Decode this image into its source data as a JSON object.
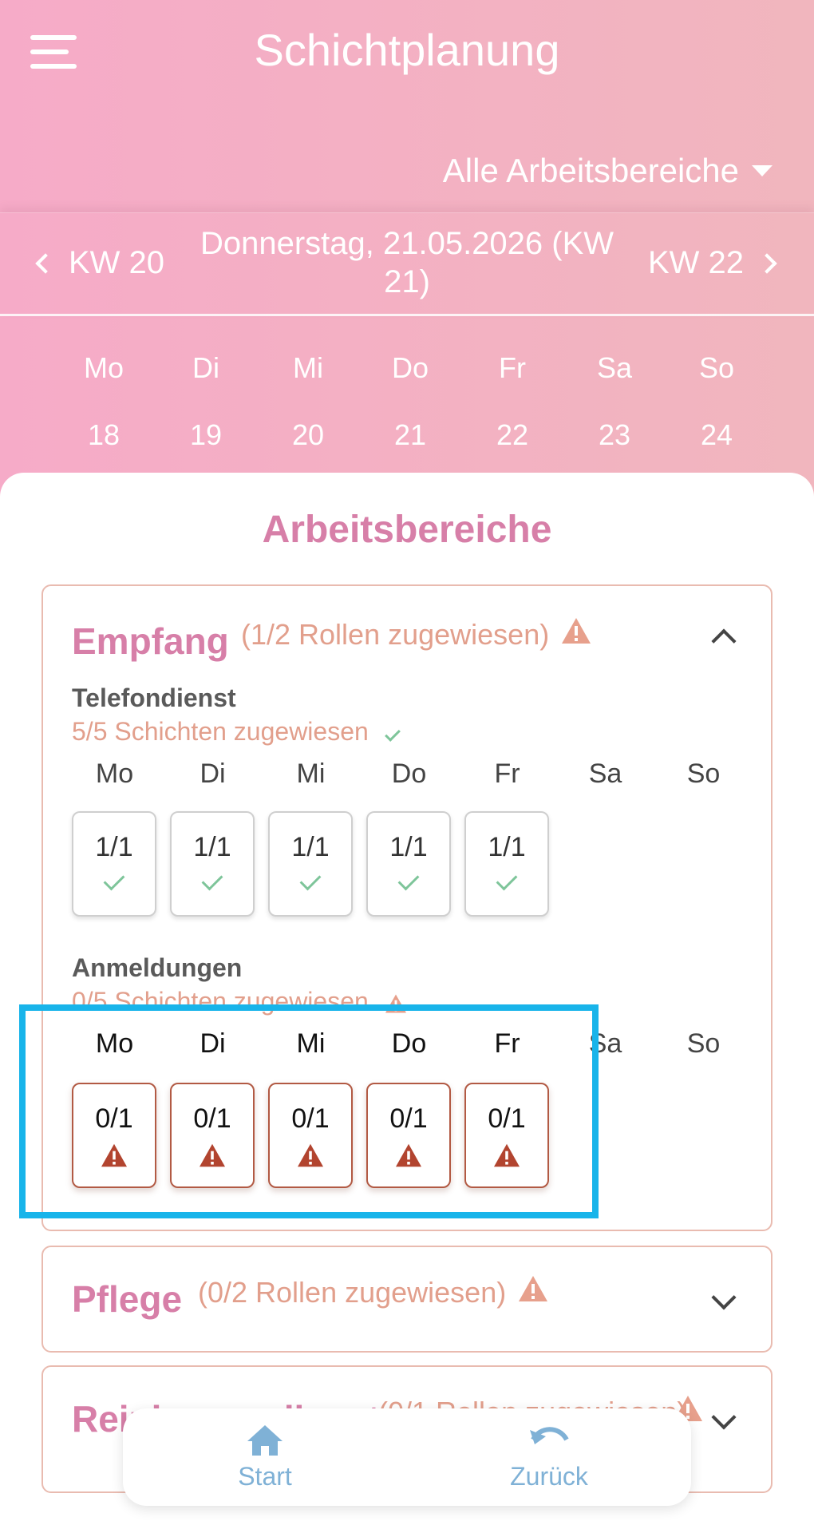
{
  "header": {
    "title": "Schichtplanung",
    "area_filter": "Alle Arbeitsbereiche"
  },
  "week_nav": {
    "prev": "KW 20",
    "current": "Donnerstag, 21.05.2026 (KW 21)",
    "next": "KW 22"
  },
  "week": {
    "days": [
      "Mo",
      "Di",
      "Mi",
      "Do",
      "Fr",
      "Sa",
      "So"
    ],
    "dates": [
      "18",
      "19",
      "20",
      "21",
      "22",
      "23",
      "24"
    ]
  },
  "sheet": {
    "title": "Arbeitsbereiche"
  },
  "areas": [
    {
      "name": "Empfang",
      "status": "(1/2 Rollen zugewiesen)",
      "roles": [
        {
          "name": "Telefondienst",
          "status": "5/5 Schichten zugewiesen",
          "days": [
            "Mo",
            "Di",
            "Mi",
            "Do",
            "Fr",
            "Sa",
            "So"
          ],
          "slots": [
            "1/1",
            "1/1",
            "1/1",
            "1/1",
            "1/1"
          ]
        },
        {
          "name": "Anmeldungen",
          "status": "0/5 Schichten zugewiesen",
          "days": [
            "Mo",
            "Di",
            "Mi",
            "Do",
            "Fr",
            "Sa",
            "So"
          ],
          "slots": [
            "0/1",
            "0/1",
            "0/1",
            "0/1",
            "0/1"
          ]
        }
      ]
    },
    {
      "name": "Pflege",
      "status": "(0/2 Rollen zugewiesen)"
    },
    {
      "name": "Reinigungsdienst",
      "status": "(0/1 Rollen zugewiesen)"
    }
  ],
  "bottom_nav": {
    "start": "Start",
    "back": "Zurück"
  },
  "colors": {
    "accent": "#d77fa8",
    "warning": "#b2442f",
    "ok": "#7ec59a",
    "highlight": "#18b4ea"
  }
}
